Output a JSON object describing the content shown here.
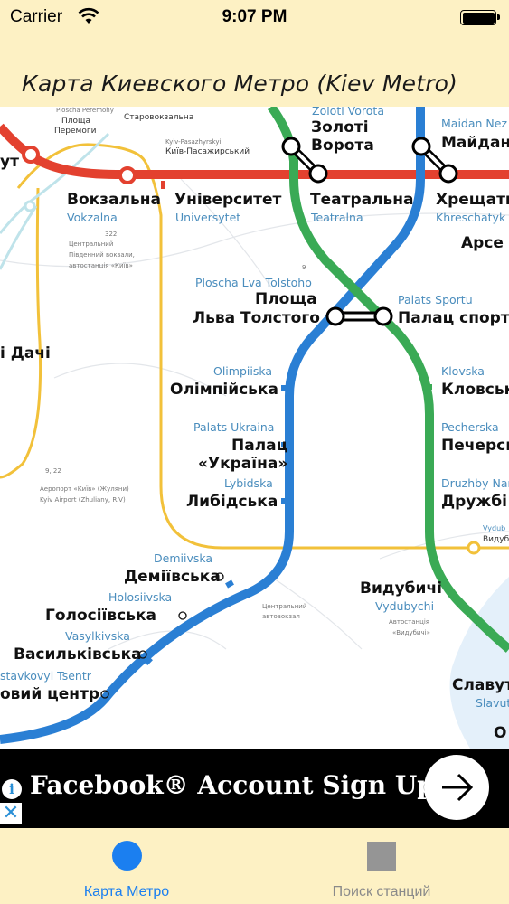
{
  "status_bar": {
    "carrier": "Carrier",
    "time": "9:07 PM"
  },
  "header": {
    "title": "Карта Киевского Метро (Kiev Metro)"
  },
  "colors": {
    "red_line": "#e3412f",
    "blue_line": "#2a7fd4",
    "green_line": "#3aaa55",
    "yellow_ring": "#f2c13a",
    "header_bg": "#fdf1c4",
    "tab_active": "#1b7ff0",
    "tab_inactive": "#8a8a8a"
  },
  "map": {
    "stations": {
      "zoloti_vorota_lat": "Zoloti Vorota",
      "zoloti_vorota_1": "Золоті",
      "zoloti_vorota_2": "Ворота",
      "maidan_lat": "Maidan Nez",
      "maidan": "Майдан",
      "teatralna": "Театральна",
      "teatralna_lat": "Teatralna",
      "khreshchatyk": "Хрещати",
      "khreshchatyk_lat": "Khreschatyk",
      "universytet": "Університет",
      "universytet_lat": "Universytet",
      "vokzalna": "Вокзальна",
      "vokzalna_lat": "Vokzalna",
      "arsenalna": "Арсе",
      "lva_tolstoho_lat": "Ploscha Lva Tolstoho",
      "lva_tolstoho_1": "Площа",
      "lva_tolstoho_2": "Льва Толстого",
      "palats_sportu_lat": "Palats Sportu",
      "palats_sportu": "Палац спорту",
      "olimpiiska_lat": "Olimpiiska",
      "olimpiiska": "Олімпійська",
      "klovska_lat": "Klovska",
      "klovska": "Кловськ",
      "palats_ukraina_lat": "Palats Ukraina",
      "palats_ukraina_1": "Палац",
      "palats_ukraina_2": "«Україна»",
      "pecherska_lat": "Pecherska",
      "pecherska": "Печерсь",
      "lybidska_lat": "Lybidska",
      "lybidska": "Либідська",
      "druzhby_lat": "Druzhby Nar",
      "druzhby": "Дружбі",
      "vydubychi_ring_lat": "Vydub",
      "vydubychi_ring": "Видуб",
      "demiivska_lat": "Demiivska",
      "demiivska": "Деміївська",
      "vydubychi": "Видубичі",
      "vydubychi_lat": "Vydubychi",
      "holosiivska_lat": "Holosiivska",
      "holosiivska": "Голосіївська",
      "vasylkivska_lat": "Vasylkivska",
      "vasylkivska": "Васильківська",
      "vystavkovyi_lat": "stavkovyi Tsentr",
      "vystavkovyi": "овий центр",
      "slavutych": "Славут",
      "slavutych_lat": "Slavut",
      "osokorky_partial": "О",
      "left_ut": "ут",
      "left_dachi": "і Дачі",
      "starovokzalna": "Старовокзальна",
      "ploshcha_peremohy_lat": "Ploscha Peremohy",
      "ploshcha_peremohy_1": "Площа",
      "ploshcha_peremohy_2": "Перемоги",
      "kyiv_pas_lat": "Kyiv-Pasazhyrskyi",
      "kyiv_pas": "Київ-Пасажирський"
    },
    "notes": {
      "central_station_1": "Центральний",
      "central_station_2": "Південний вокзали,",
      "central_station_3": "автостанція «Київ»",
      "airport_1": "Аеропорт «Київ» (Жуляни)",
      "airport_2": "Kyiv Airport (Zhuliany, R.V)",
      "bus_station_1": "Центральний",
      "bus_station_2": "автовокзал",
      "vydub_bus_1": "Автостанція",
      "vydub_bus_2": "«Видубичі»",
      "bus_322": "322",
      "bus_9_22": "9, 22",
      "bus_9": "9"
    }
  },
  "ad": {
    "text": "Facebook® Account Sign Up",
    "info_glyph": "i",
    "close_glyph": "✕"
  },
  "tabs": [
    {
      "label": "Карта Метро"
    },
    {
      "label": "Поиск станций"
    }
  ]
}
